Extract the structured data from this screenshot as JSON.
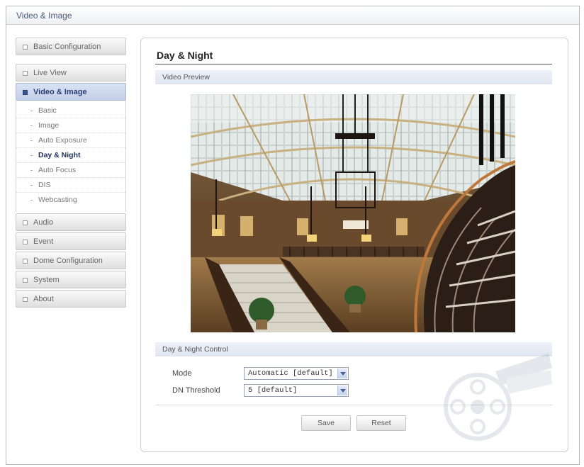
{
  "window": {
    "title": "Video & Image"
  },
  "sidebar": {
    "items": [
      {
        "label": "Basic Configuration"
      },
      {
        "label": "Live View"
      },
      {
        "label": "Video & Image"
      },
      {
        "label": "Audio"
      },
      {
        "label": "Event"
      },
      {
        "label": "Dome Configuration"
      },
      {
        "label": "System"
      },
      {
        "label": "About"
      }
    ],
    "subitems": [
      {
        "label": "Basic"
      },
      {
        "label": "Image"
      },
      {
        "label": "Auto Exposure"
      },
      {
        "label": "Day & Night"
      },
      {
        "label": "Auto Focus"
      },
      {
        "label": "DIS"
      },
      {
        "label": "Webcasting"
      }
    ],
    "active_item": "Video & Image",
    "current_subitem": "Day & Night"
  },
  "main": {
    "title": "Day & Night",
    "preview_section": {
      "label": "Video Preview"
    },
    "control_section": {
      "label": "Day & Night Control"
    },
    "fields": {
      "mode": {
        "label": "Mode",
        "value": "Automatic [default]"
      },
      "dn_threshold": {
        "label": "DN Threshold",
        "value": "5 [default]"
      }
    },
    "buttons": {
      "save": "Save",
      "reset": "Reset"
    }
  },
  "colors": {
    "accent": "#3a5595",
    "section_bar": "#dfe5f1",
    "active_nav": "#c3cfe8"
  }
}
